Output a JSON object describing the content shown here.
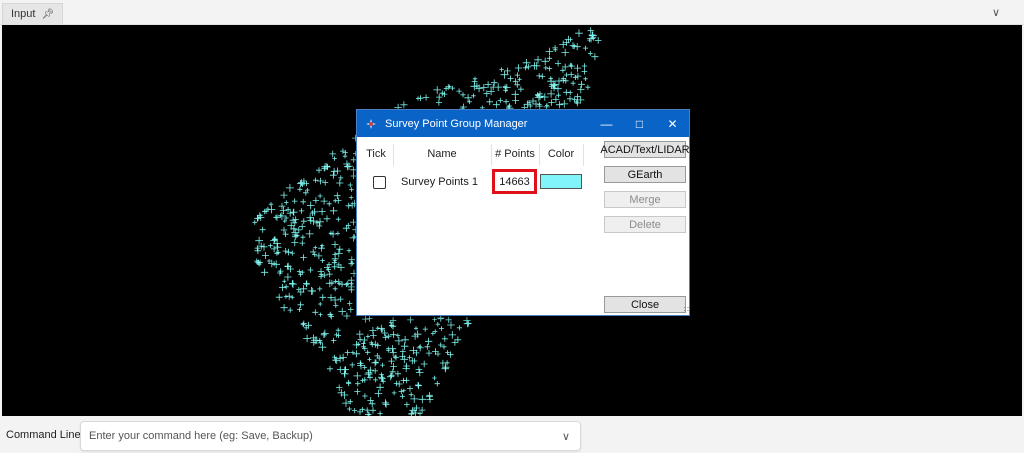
{
  "tab": {
    "label": "Input",
    "pin_icon": "pin-icon"
  },
  "collapse_icon": "chevron-down-icon",
  "viewport": {
    "point_color": "#7ef5ee",
    "background": "#000000"
  },
  "dialog": {
    "title": "Survey Point Group Manager",
    "columns": [
      "Tick",
      "Name",
      "# Points",
      "Color"
    ],
    "rows": [
      {
        "tick": false,
        "name": "Survey Points 1",
        "points": "14663",
        "color": "#80f4f8"
      }
    ],
    "buttons": {
      "acad": "ACAD/Text/LIDAR",
      "gearth": "GEarth",
      "merge": "Merge",
      "delete": "Delete",
      "close": "Close"
    }
  },
  "command_line": {
    "label": "Command Line:",
    "placeholder": "Enter your command here (eg: Save, Backup)",
    "value": ""
  }
}
